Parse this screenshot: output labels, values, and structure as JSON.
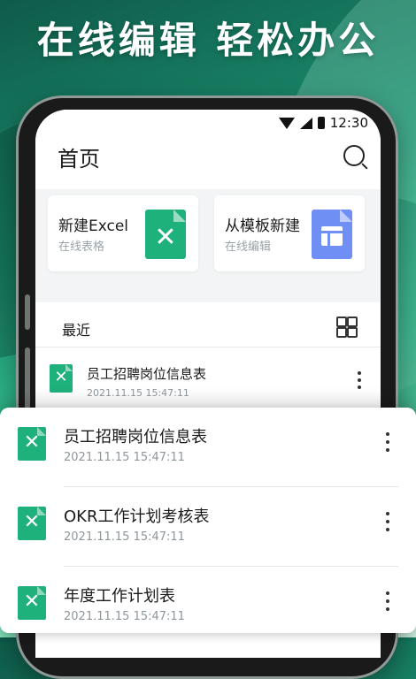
{
  "headline": "在线编辑 轻松办公",
  "status": {
    "time": "12:30"
  },
  "home": {
    "title": "首页"
  },
  "cards": [
    {
      "title": "新建Excel",
      "subtitle": "在线表格",
      "icon": "excel-file-icon",
      "color": "#1fb17b"
    },
    {
      "title": "从模板新建",
      "subtitle": "在线编辑",
      "icon": "template-file-icon",
      "color": "#6f8ff5"
    }
  ],
  "recent": {
    "label": "最近",
    "items": [
      {
        "name": "员工招聘岗位信息表",
        "time": "2021.11.15  15:47:11"
      }
    ]
  },
  "overlay": {
    "items": [
      {
        "name": "员工招聘岗位信息表",
        "time": "2021.11.15  15:47:11"
      },
      {
        "name": "OKR工作计划考核表",
        "time": "2021.11.15  15:47:11"
      },
      {
        "name": "年度工作计划表",
        "time": "2021.11.15  15:47:11"
      }
    ]
  },
  "icons": {
    "x": "✕"
  },
  "colors": {
    "accent": "#1fb17b",
    "template": "#6f8ff5"
  }
}
